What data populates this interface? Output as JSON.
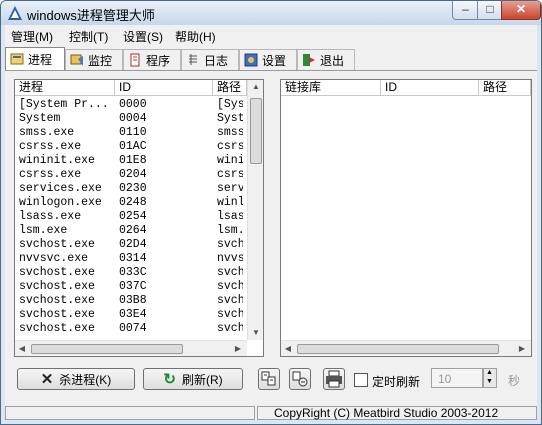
{
  "window": {
    "title": "windows进程管理大师",
    "min_glyph": "‒",
    "max_glyph": "□",
    "close_glyph": "✕"
  },
  "menu": [
    "管理(M)",
    "控制(T)",
    "设置(S)",
    "帮助(H)"
  ],
  "tabs": [
    "进程",
    "监控",
    "程序",
    "日志",
    "设置",
    "退出"
  ],
  "process_list": {
    "columns": [
      "进程",
      "ID",
      "路径"
    ],
    "rows": [
      [
        "[System Pr...",
        "0000",
        "[Sys"
      ],
      [
        "System",
        "0004",
        "Syst"
      ],
      [
        "smss.exe",
        "0110",
        "smss"
      ],
      [
        "csrss.exe",
        "01AC",
        "csrs"
      ],
      [
        "wininit.exe",
        "01E8",
        "wini"
      ],
      [
        "csrss.exe",
        "0204",
        "csrs"
      ],
      [
        "services.exe",
        "0230",
        "serv"
      ],
      [
        "winlogon.exe",
        "0248",
        "winl"
      ],
      [
        "lsass.exe",
        "0254",
        "lsas"
      ],
      [
        "lsm.exe",
        "0264",
        "lsm."
      ],
      [
        "svchost.exe",
        "02D4",
        "svch"
      ],
      [
        "nvvsvc.exe",
        "0314",
        "nvvs"
      ],
      [
        "svchost.exe",
        "033C",
        "svch"
      ],
      [
        "svchost.exe",
        "037C",
        "svch"
      ],
      [
        "svchost.exe",
        "03B8",
        "svch"
      ],
      [
        "svchost.exe",
        "03E4",
        "svch"
      ],
      [
        "svchost.exe",
        "0074",
        "svch"
      ]
    ]
  },
  "module_list": {
    "columns": [
      "链接库",
      "ID",
      "路径"
    ]
  },
  "buttons": {
    "kill": "杀进程(K)",
    "kill_icon": "✕",
    "refresh": "刷新(R)",
    "refresh_icon": "↻",
    "timer_checkbox": "定时刷新",
    "interval_value": "10",
    "interval_unit": "秒"
  },
  "status": {
    "copyright": "CopyRight (C) Meatbird Studio 2003-2012"
  },
  "colors": {
    "window_frame": "#dbe6f2",
    "refresh_arrow": "#1a8a2a",
    "kill_x": "#222222"
  }
}
